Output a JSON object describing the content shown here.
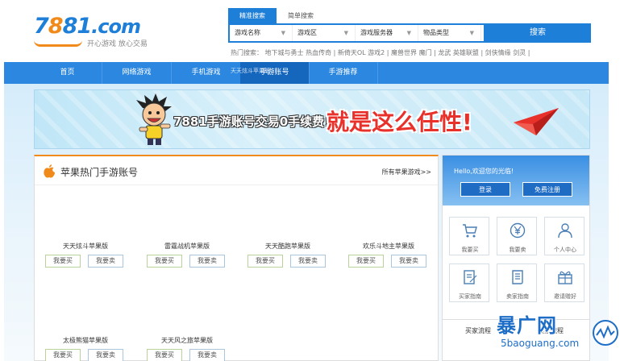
{
  "logo": {
    "brand_pre": "7",
    "brand_mid": "8",
    "brand_post": "81",
    "brand_com": ".com",
    "slogan": "开心游戏 放心交易"
  },
  "search": {
    "tabs": [
      "精准搜索",
      "简单搜索"
    ],
    "fields": [
      "游戏名称",
      "游戏区",
      "游戏服务器",
      "物品类型"
    ],
    "button": "搜索"
  },
  "hot_search": "热门搜索：  地下城与勇士  热血传奇  |  新倚天OL  游戏2  |  魔兽世界  魔门  |  龙武  英雄联盟  |  剑侠情缘  剑灵  |",
  "nav": {
    "items": [
      "首页",
      "网络游戏",
      "手机游戏",
      "手游账号",
      "手游推荐"
    ],
    "dropdown_hint": "天天炫斗苹果版"
  },
  "banner": {
    "text": "7881手游账号交易0手续费！",
    "slogan": "就是这么任性!"
  },
  "main": {
    "title": "苹果热门手游账号",
    "more": "所有苹果游戏>>",
    "games": [
      {
        "name": "天天炫斗苹果版",
        "buy": "我要买",
        "sell": "我要卖"
      },
      {
        "name": "雷霆战机苹果版",
        "buy": "我要买",
        "sell": "我要卖"
      },
      {
        "name": "天天酷跑苹果版",
        "buy": "我要买",
        "sell": "我要卖"
      },
      {
        "name": "欢乐斗地主苹果版",
        "buy": "我要买",
        "sell": "我要卖"
      },
      {
        "name": "太极熊猫苹果版",
        "buy": "我要买",
        "sell": "我要卖"
      },
      {
        "name": "天天风之旅苹果版",
        "buy": "我要买",
        "sell": "我要卖"
      }
    ]
  },
  "side": {
    "hello": "Hello,欢迎您的光临!",
    "login": "登录",
    "register": "免费注册",
    "tiles": [
      {
        "label": "我要买",
        "icon": "cart-icon"
      },
      {
        "label": "我要卖",
        "icon": "yen-icon"
      },
      {
        "label": "个人中心",
        "icon": "user-icon"
      },
      {
        "label": "买家指南",
        "icon": "edit-icon"
      },
      {
        "label": "卖家指南",
        "icon": "scroll-icon"
      },
      {
        "label": "邀请赠好",
        "icon": "gift-icon"
      }
    ],
    "flow_buyer": "买家流程",
    "flow_seller": "卖家流程"
  },
  "watermark": {
    "brand": "暴广网",
    "url": "5baoguang.com"
  },
  "colors": {
    "primary": "#2b87df",
    "accent": "#f08a1a",
    "nav_active": "#1566bd"
  }
}
